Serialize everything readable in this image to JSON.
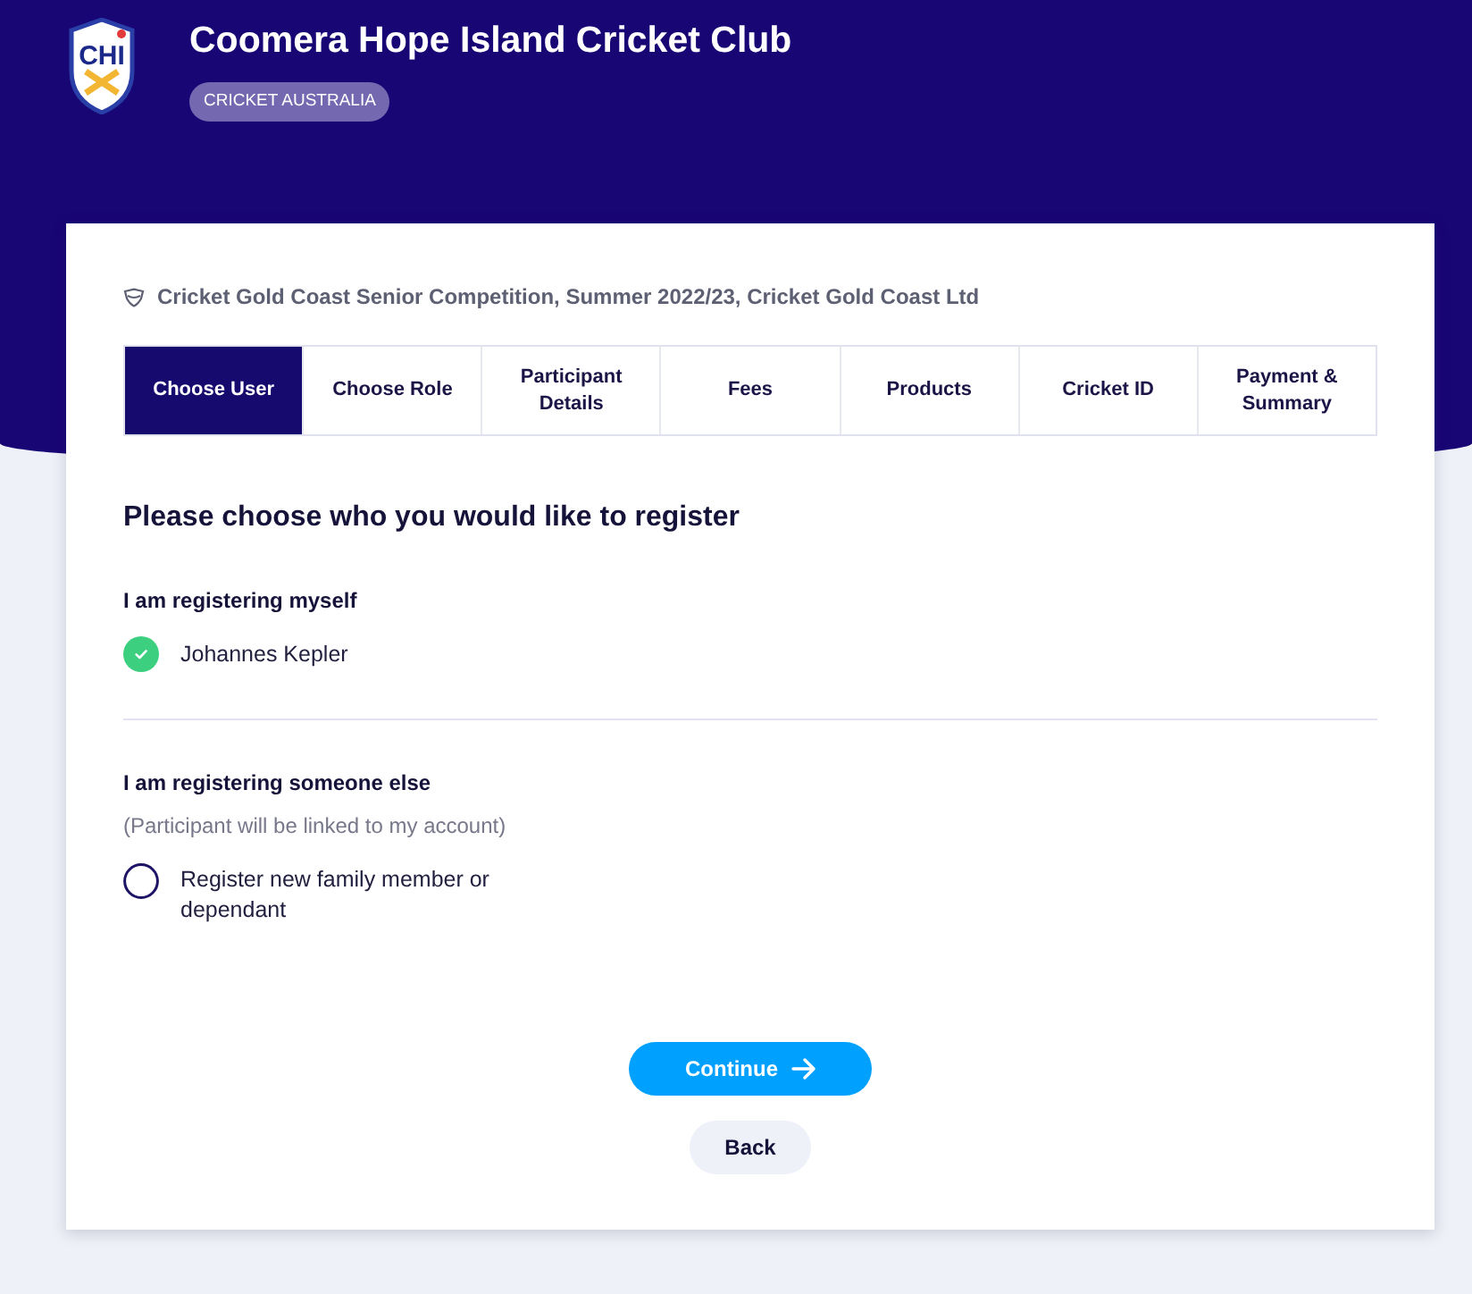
{
  "header": {
    "logo_letters": "CHI",
    "club_name": "Coomera Hope Island Cricket Club",
    "badge": "CRICKET AUSTRALIA"
  },
  "competition": "Cricket Gold Coast Senior Competition, Summer 2022/23, Cricket Gold Coast Ltd",
  "steps": [
    {
      "label": "Choose User",
      "selected": true
    },
    {
      "label": "Choose Role",
      "selected": false
    },
    {
      "label": "Participant Details",
      "selected": false
    },
    {
      "label": "Fees",
      "selected": false
    },
    {
      "label": "Products",
      "selected": false
    },
    {
      "label": "Cricket ID",
      "selected": false
    },
    {
      "label": "Payment & Summary",
      "selected": false
    }
  ],
  "heading": "Please choose who you would like to register",
  "sections": [
    {
      "title": "I am registering myself",
      "options": [
        {
          "label": "Johannes Kepler",
          "selected": true
        }
      ]
    },
    {
      "title": "I am registering someone else",
      "note": "(Participant will be linked to my account)",
      "options": [
        {
          "label": "Register new family member or dependant",
          "selected": false
        }
      ]
    }
  ],
  "buttons": {
    "continue": "Continue",
    "back": "Back"
  }
}
